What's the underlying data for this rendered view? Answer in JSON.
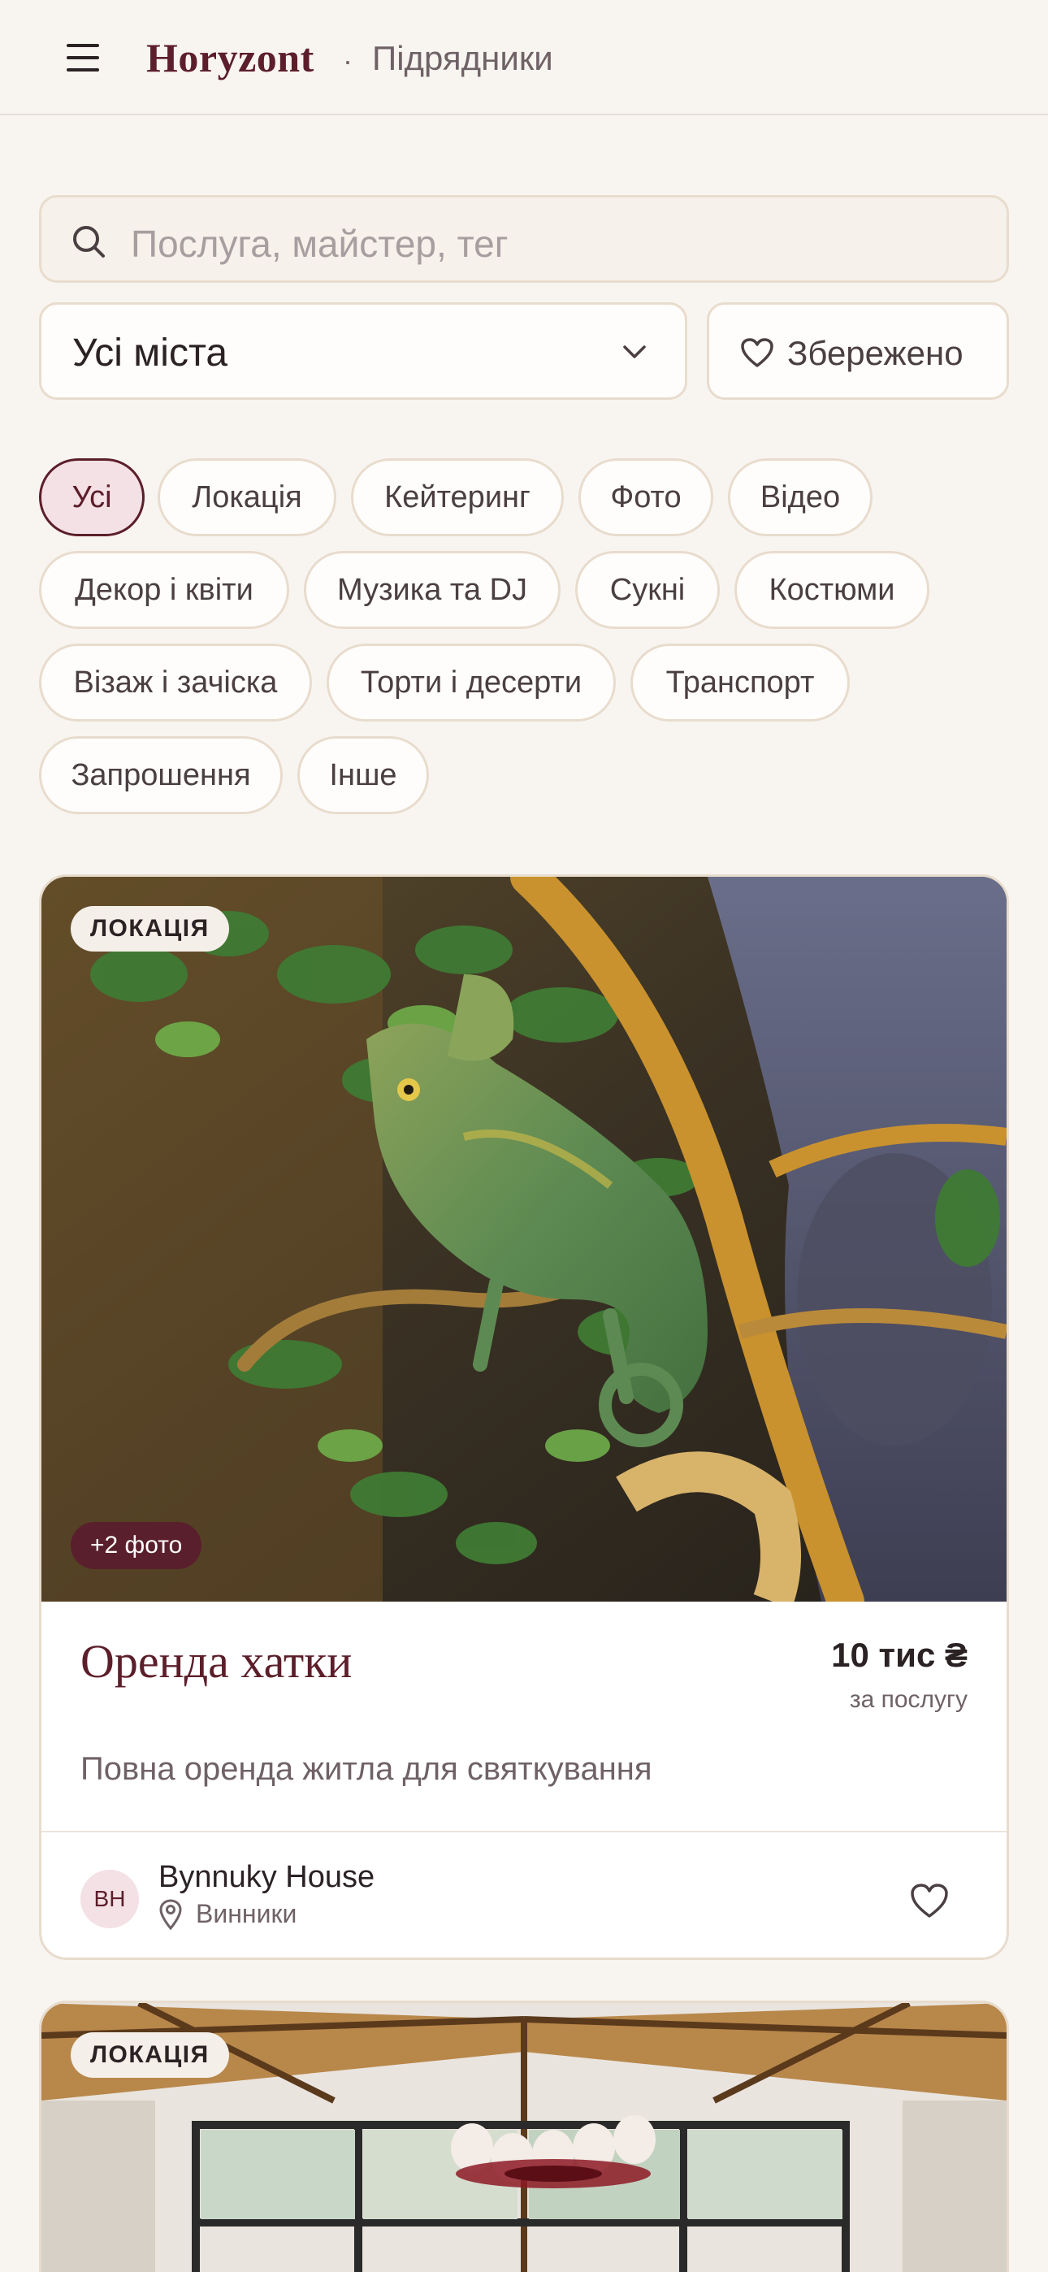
{
  "header": {
    "brand": "Horyzont",
    "separator": "·",
    "section": "Підрядники"
  },
  "search": {
    "placeholder": "Послуга, майстер, тег"
  },
  "filters": {
    "city": "Усі міста",
    "saved_label": "Збережено"
  },
  "categories": [
    "Усі",
    "Локація",
    "Кейтеринг",
    "Фото",
    "Відео",
    "Декор і квіти",
    "Музика та DJ",
    "Сукні",
    "Костюми",
    "Візаж і зачіска",
    "Торти і десерти",
    "Транспорт",
    "Запрошення",
    "Інше"
  ],
  "active_category": "Усі",
  "listings": [
    {
      "tag": "ЛОКАЦІЯ",
      "photos_more": "+2 фото",
      "title": "Оренда хатки",
      "price": "10 тис ₴",
      "price_unit": "за послугу",
      "description": "Повна оренда житла для святкування",
      "vendor_initials": "BH",
      "vendor_name": "Bynnuky House",
      "vendor_city": "Винники"
    },
    {
      "tag": "ЛОКАЦІЯ"
    }
  ],
  "colors": {
    "accent": "#5c1e2a",
    "background": "#f8f5f1",
    "border": "#e8dccd"
  }
}
